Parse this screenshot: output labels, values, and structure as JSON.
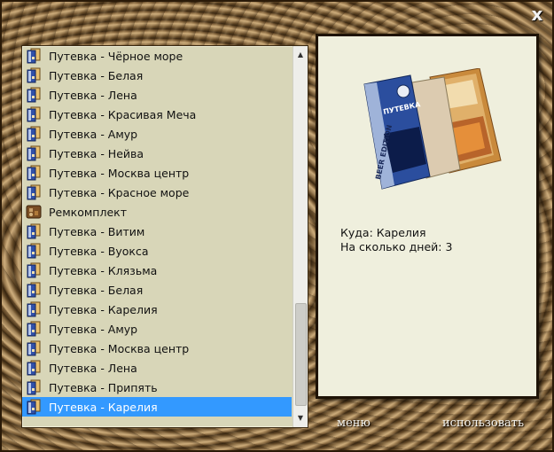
{
  "window": {
    "close_glyph": "x"
  },
  "list": {
    "items": [
      {
        "label": "Путевка - Чёрное море",
        "icon": "voucher-icon"
      },
      {
        "label": "Путевка - Белая",
        "icon": "voucher-icon"
      },
      {
        "label": "Путевка - Лена",
        "icon": "voucher-icon"
      },
      {
        "label": "Путевка - Красивая Меча",
        "icon": "voucher-icon"
      },
      {
        "label": "Путевка - Амур",
        "icon": "voucher-icon"
      },
      {
        "label": "Путевка - Нейва",
        "icon": "voucher-icon"
      },
      {
        "label": "Путевка - Москва центр",
        "icon": "voucher-icon"
      },
      {
        "label": "Путевка - Красное море",
        "icon": "voucher-icon"
      },
      {
        "label": "Ремкомплект",
        "icon": "repair-kit-icon"
      },
      {
        "label": "Путевка - Витим",
        "icon": "voucher-icon"
      },
      {
        "label": "Путевка - Вуокса",
        "icon": "voucher-icon"
      },
      {
        "label": "Путевка - Клязьма",
        "icon": "voucher-icon"
      },
      {
        "label": "Путевка - Белая",
        "icon": "voucher-icon"
      },
      {
        "label": "Путевка - Карелия",
        "icon": "voucher-icon"
      },
      {
        "label": "Путевка - Амур",
        "icon": "voucher-icon"
      },
      {
        "label": "Путевка - Москва центр",
        "icon": "voucher-icon"
      },
      {
        "label": "Путевка - Лена",
        "icon": "voucher-icon"
      },
      {
        "label": "Путевка - Припять",
        "icon": "voucher-icon"
      },
      {
        "label": "Путевка - Карелия",
        "icon": "voucher-icon",
        "selected": true
      }
    ],
    "selected_color": "#3399ff"
  },
  "details": {
    "image_icon": "brochure-image",
    "brochure_title": "ПУТЕВКА",
    "brochure_edition": "BEER EDITION",
    "destination_line": "Куда: Карелия",
    "days_line": "На сколько дней: 3"
  },
  "buttons": {
    "menu_label": "меню",
    "use_label": "использовать"
  }
}
